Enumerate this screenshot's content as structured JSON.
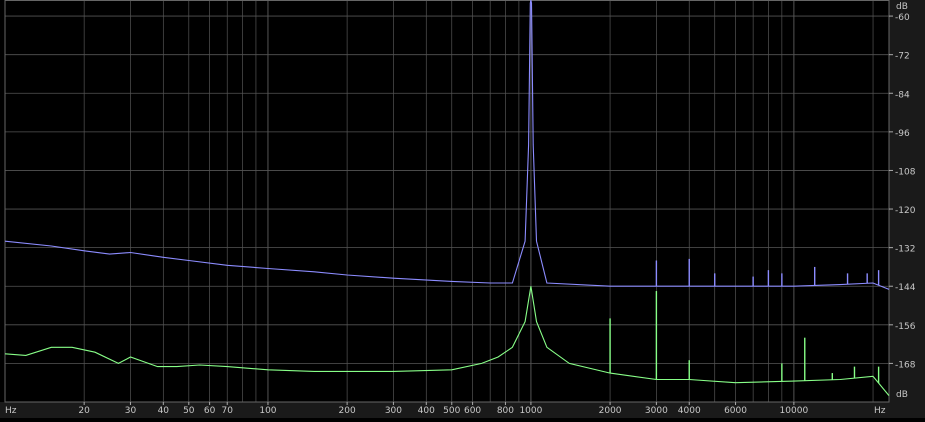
{
  "chart_data": {
    "type": "line",
    "xlabel": "Hz",
    "ylabel": "dB",
    "x_scale": "log",
    "xlim": [
      10,
      23000
    ],
    "ylim": [
      -180,
      -55
    ],
    "grid": true,
    "x_ticks": [
      {
        "v": 20,
        "label": "20"
      },
      {
        "v": 30,
        "label": "30"
      },
      {
        "v": 40,
        "label": "40"
      },
      {
        "v": 50,
        "label": "50"
      },
      {
        "v": 60,
        "label": "60"
      },
      {
        "v": 70,
        "label": "70"
      },
      {
        "v": 100,
        "label": "100"
      },
      {
        "v": 200,
        "label": "200"
      },
      {
        "v": 300,
        "label": "300"
      },
      {
        "v": 400,
        "label": "400"
      },
      {
        "v": 500,
        "label": "500"
      },
      {
        "v": 600,
        "label": "600"
      },
      {
        "v": 800,
        "label": "800"
      },
      {
        "v": 1000,
        "label": "1000"
      },
      {
        "v": 2000,
        "label": "2000"
      },
      {
        "v": 3000,
        "label": "3000"
      },
      {
        "v": 4000,
        "label": "4000"
      },
      {
        "v": 6000,
        "label": "6000"
      },
      {
        "v": 10000,
        "label": "10000"
      }
    ],
    "y_ticks": [
      {
        "v": -60,
        "label": "-60"
      },
      {
        "v": -72,
        "label": "-72"
      },
      {
        "v": -84,
        "label": "-84"
      },
      {
        "v": -96,
        "label": "-96"
      },
      {
        "v": -108,
        "label": "-108"
      },
      {
        "v": -120,
        "label": "-120"
      },
      {
        "v": -132,
        "label": "-132"
      },
      {
        "v": -144,
        "label": "-144"
      },
      {
        "v": -156,
        "label": "-156"
      },
      {
        "v": -168,
        "label": "-168"
      }
    ],
    "series": [
      {
        "color": "#8c8cff",
        "points": [
          [
            10,
            -130
          ],
          [
            15,
            -131.5
          ],
          [
            20,
            -133
          ],
          [
            25,
            -134
          ],
          [
            30,
            -133.5
          ],
          [
            40,
            -135
          ],
          [
            50,
            -136
          ],
          [
            70,
            -137.5
          ],
          [
            100,
            -138.5
          ],
          [
            150,
            -139.5
          ],
          [
            200,
            -140.5
          ],
          [
            300,
            -141.5
          ],
          [
            500,
            -142.5
          ],
          [
            700,
            -143
          ],
          [
            850,
            -143
          ],
          [
            950,
            -130
          ],
          [
            980,
            -100
          ],
          [
            995,
            -56
          ],
          [
            1000,
            -55
          ],
          [
            1005,
            -56
          ],
          [
            1020,
            -100
          ],
          [
            1050,
            -130
          ],
          [
            1150,
            -143
          ],
          [
            2000,
            -144
          ],
          [
            3000,
            -144
          ],
          [
            4000,
            -144
          ],
          [
            6000,
            -144
          ],
          [
            10000,
            -144
          ],
          [
            15000,
            -143.5
          ],
          [
            20000,
            -143
          ],
          [
            23000,
            -145
          ]
        ],
        "peaks": [
          {
            "x": 2000,
            "y": -144
          },
          {
            "x": 3000,
            "y": -136
          },
          {
            "x": 4000,
            "y": -135.5
          },
          {
            "x": 5000,
            "y": -140
          },
          {
            "x": 7000,
            "y": -141
          },
          {
            "x": 8000,
            "y": -139
          },
          {
            "x": 9000,
            "y": -140
          },
          {
            "x": 12000,
            "y": -138
          },
          {
            "x": 16000,
            "y": -140
          },
          {
            "x": 19000,
            "y": -140
          },
          {
            "x": 21000,
            "y": -139
          }
        ]
      },
      {
        "color": "#88ff88",
        "points": [
          [
            10,
            -165
          ],
          [
            12,
            -165.5
          ],
          [
            15,
            -163
          ],
          [
            18,
            -163
          ],
          [
            22,
            -164.5
          ],
          [
            27,
            -168
          ],
          [
            30,
            -166
          ],
          [
            38,
            -169
          ],
          [
            45,
            -169
          ],
          [
            55,
            -168.5
          ],
          [
            70,
            -169
          ],
          [
            100,
            -170
          ],
          [
            150,
            -170.5
          ],
          [
            200,
            -170.5
          ],
          [
            300,
            -170.5
          ],
          [
            500,
            -170
          ],
          [
            650,
            -168
          ],
          [
            750,
            -166
          ],
          [
            850,
            -163
          ],
          [
            950,
            -155
          ],
          [
            1000,
            -144
          ],
          [
            1050,
            -155
          ],
          [
            1150,
            -163
          ],
          [
            1400,
            -168
          ],
          [
            2000,
            -171
          ],
          [
            3000,
            -173
          ],
          [
            4000,
            -173
          ],
          [
            6000,
            -174
          ],
          [
            10000,
            -173.5
          ],
          [
            15000,
            -173
          ],
          [
            20000,
            -172
          ],
          [
            23000,
            -178
          ]
        ],
        "peaks": [
          {
            "x": 2000,
            "y": -154
          },
          {
            "x": 3000,
            "y": -145.5
          },
          {
            "x": 4000,
            "y": -167
          },
          {
            "x": 9000,
            "y": -168
          },
          {
            "x": 11000,
            "y": -160
          },
          {
            "x": 14000,
            "y": -171
          },
          {
            "x": 17000,
            "y": -169
          },
          {
            "x": 21000,
            "y": -169
          }
        ]
      }
    ]
  }
}
